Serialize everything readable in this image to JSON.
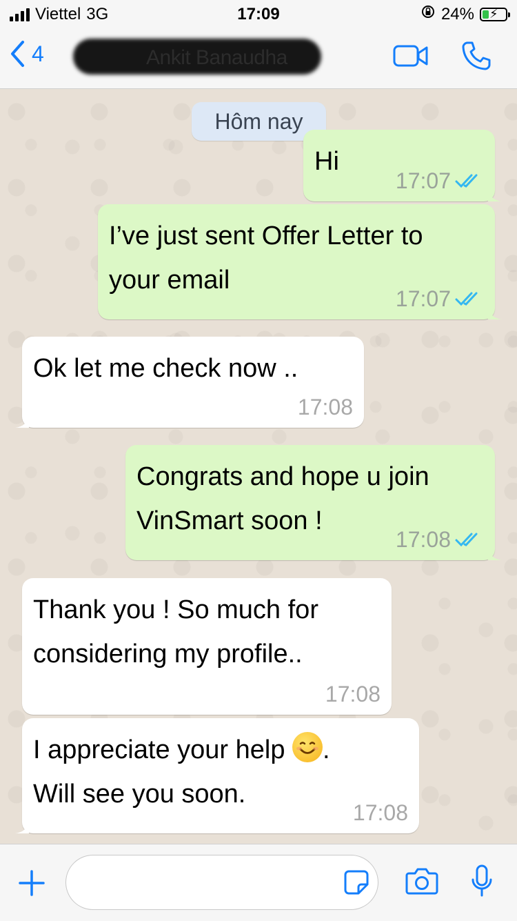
{
  "status_bar": {
    "carrier": "Viettel",
    "network": "3G",
    "time": "17:09",
    "battery_percent": "24%"
  },
  "nav": {
    "back_count": "4",
    "contact_name": "Ankit Banaudha",
    "video_icon": "video-call-icon",
    "phone_icon": "phone-icon",
    "accent_color": "#147efb"
  },
  "chat": {
    "date_label": "Hôm nay",
    "messages": [
      {
        "direction": "out",
        "text": "Hi",
        "time": "17:07",
        "read": true
      },
      {
        "direction": "out",
        "text": "I’ve just sent Offer Letter to\nyour email",
        "time": "17:07",
        "read": true
      },
      {
        "direction": "in",
        "text": "Ok let me check now ..",
        "time": "17:08"
      },
      {
        "direction": "out",
        "text": "Congrats and hope u join\nVinSmart soon !",
        "time": "17:08",
        "read": true
      },
      {
        "direction": "in",
        "text": "Thank you ! So much for\nconsidering my profile..",
        "time": "17:08"
      },
      {
        "direction": "in",
        "text_before_emoji": "I appreciate your help ",
        "text_after_emoji": ".",
        "text_line2": "Will see you soon.",
        "emoji": "smiling-face-emoji",
        "time": "17:08"
      }
    ],
    "colors": {
      "outgoing_bubble": "#dcf8c6",
      "incoming_bubble": "#ffffff",
      "read_ticks": "#34b7f1"
    }
  },
  "input_bar": {
    "message_value": "",
    "icons": [
      "plus-icon",
      "sticker-icon",
      "camera-icon",
      "microphone-icon"
    ]
  }
}
